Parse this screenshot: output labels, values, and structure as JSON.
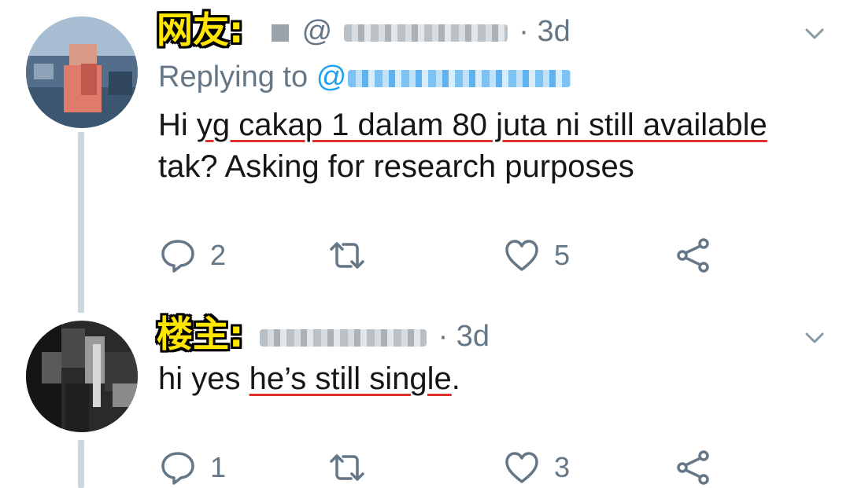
{
  "tweets": [
    {
      "tag": "网友:",
      "handle_prefix": "@",
      "time": "· 3d",
      "replying_to_label": "Replying to",
      "reply_at": "@",
      "text_line1_before": "Hi ",
      "text_line1_underlined": "yg cakap 1 dalam 80 juta ni still available",
      "text_line2": "tak? Asking for research purposes",
      "reply_count": "2",
      "retweet_count": "",
      "like_count": "5"
    },
    {
      "tag": "楼主:",
      "time": "· 3d",
      "text_before": "hi yes ",
      "text_underlined": "he’s still single",
      "text_after": ".",
      "reply_count": "1",
      "retweet_count": "",
      "like_count": "3"
    }
  ],
  "colors": {
    "tag_yellow": "#ffe600",
    "meta_gray": "#657786",
    "link_blue": "#1da1f2",
    "underline_red": "#e03131",
    "thread_line": "#ccd6dd"
  },
  "icons": [
    "chevron-down-icon",
    "reply-icon",
    "retweet-icon",
    "like-icon",
    "share-icon"
  ]
}
